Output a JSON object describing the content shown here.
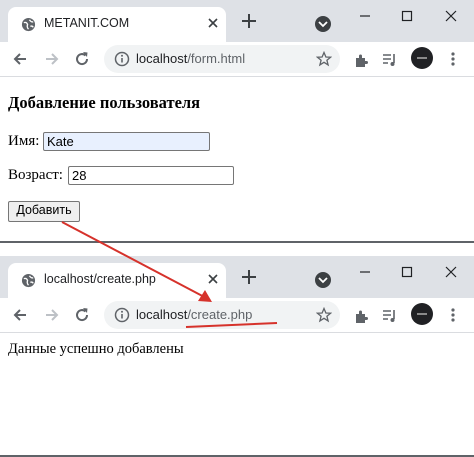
{
  "colors": {
    "accent_arrow": "#d6322b",
    "tabstrip": "#dee1e6",
    "omnibox": "#f1f3f4",
    "autofill": "#e8f0fe"
  },
  "window1": {
    "tab_title": "METANIT.COM",
    "url_host": "localhost",
    "url_path": "/form.html",
    "page": {
      "heading": "Добавление пользователя",
      "name_label": "Имя:",
      "name_value": "Kate",
      "age_label": "Возраст:",
      "age_value": "28",
      "submit_label": "Добавить"
    }
  },
  "window2": {
    "tab_title": "localhost/create.php",
    "url_host": "localhost",
    "url_path": "/create.php",
    "page": {
      "message": "Данные успешно добавлены"
    }
  },
  "icons": [
    "globe-icon",
    "close-icon",
    "plus-icon",
    "tab-search-icon",
    "minimize-icon",
    "maximize-icon",
    "back-icon",
    "forward-icon",
    "reload-icon",
    "info-icon",
    "star-icon",
    "extensions-icon",
    "media-icon",
    "avatar",
    "menu-icon"
  ]
}
